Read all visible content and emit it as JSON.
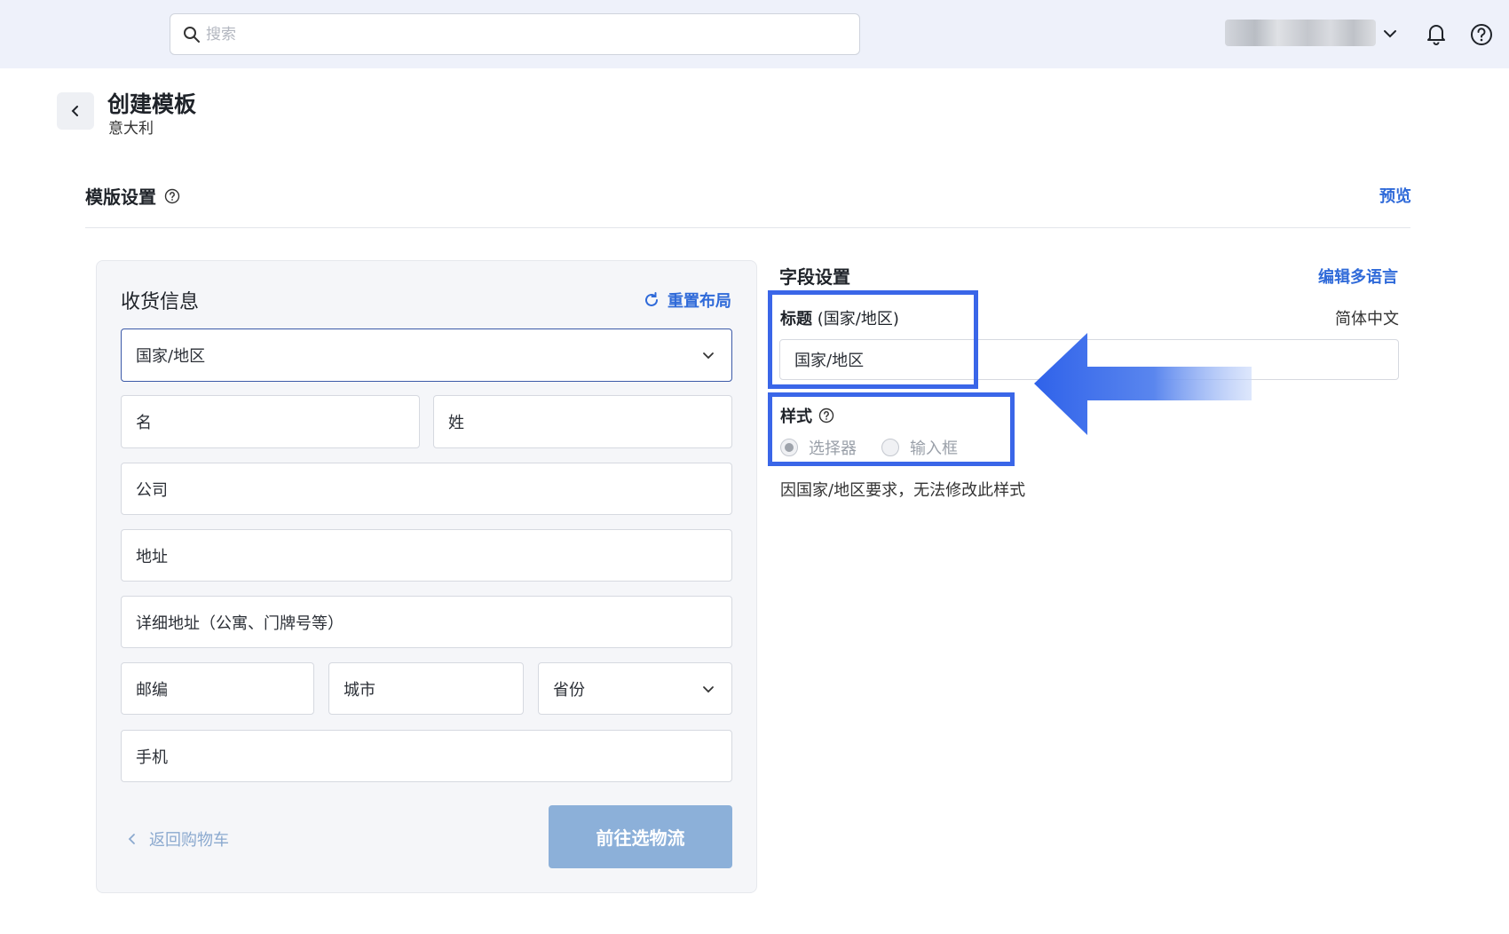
{
  "search": {
    "placeholder": "搜索"
  },
  "header": {
    "title": "创建模板",
    "subtitle": "意大利"
  },
  "section": {
    "title": "模版设置",
    "preview_label": "预览"
  },
  "form": {
    "title": "收货信息",
    "reset_label": "重置布局",
    "fields": {
      "country": "国家/地区",
      "first_name": "名",
      "last_name": "姓",
      "company": "公司",
      "address": "地址",
      "address2": "详细地址（公寓、门牌号等）",
      "zip": "邮编",
      "city": "城市",
      "province": "省份",
      "phone": "手机"
    },
    "back_label": "返回购物车",
    "submit_label": "前往选物流"
  },
  "field_settings": {
    "title": "字段设置",
    "multilang_label": "编辑多语言",
    "label_prefix": "标题",
    "label_field": "(国家/地区)",
    "language": "简体中文",
    "title_value": "国家/地区",
    "style_label": "样式",
    "options": [
      "选择器",
      "输入框"
    ],
    "selected_option": "选择器",
    "note": "因国家/地区要求，无法修改此样式"
  },
  "colors": {
    "accent": "#2f6ad9",
    "highlight": "#3a66e8",
    "button_disabled": "#8cb0d9"
  }
}
